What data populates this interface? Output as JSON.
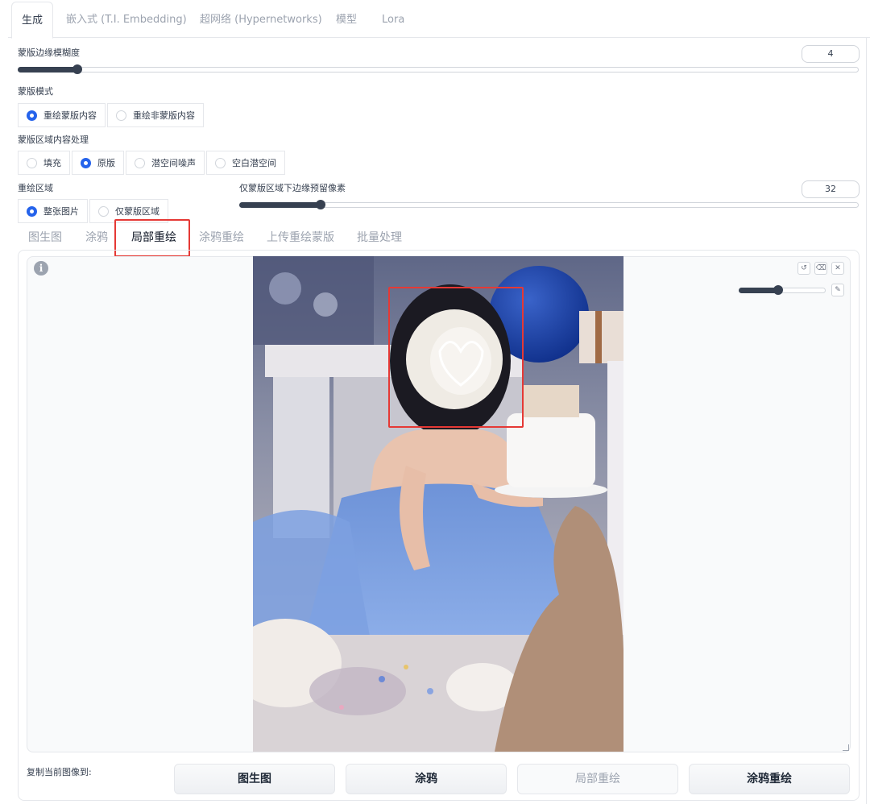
{
  "top_tabs": [
    "生成",
    "嵌入式 (T.I. Embedding)",
    "超网络 (Hypernetworks)",
    "模型",
    "Lora"
  ],
  "mask_blur": {
    "label": "蒙版边缘模糊度",
    "value": "4",
    "fraction": 0.07
  },
  "mask_mode": {
    "label": "蒙版模式",
    "options": [
      "重绘蒙版内容",
      "重绘非蒙版内容"
    ],
    "selected": "重绘蒙版内容"
  },
  "masked_content": {
    "label": "蒙版区域内容处理",
    "options": [
      "填充",
      "原版",
      "潜空间噪声",
      "空白潜空间"
    ],
    "selected": "原版"
  },
  "inpaint_area": {
    "label": "重绘区域",
    "options": [
      "整张图片",
      "仅蒙版区域"
    ],
    "selected": "整张图片"
  },
  "padding": {
    "label": "仅蒙版区域下边缘预留像素",
    "value": "32",
    "fraction": 0.13
  },
  "sub_tabs": [
    "图生图",
    "涂鸦",
    "局部重绘",
    "涂鸦重绘",
    "上传重绘蒙版",
    "批量处理"
  ],
  "active_sub_tab": "局部重绘",
  "editor": {
    "brush_fraction": 0.45
  },
  "copy": {
    "label": "复制当前图像到:",
    "buttons": [
      "图生图",
      "涂鸦",
      "局部重绘",
      "涂鸦重绘"
    ]
  },
  "colors": {
    "accent": "#2563eb",
    "highlight": "#e53935"
  },
  "icons": {
    "info": "info-icon",
    "undo": "undo-icon",
    "clear": "eraser-icon",
    "close": "close-icon",
    "brush": "brush-icon",
    "resize": "resize-grip-icon"
  }
}
